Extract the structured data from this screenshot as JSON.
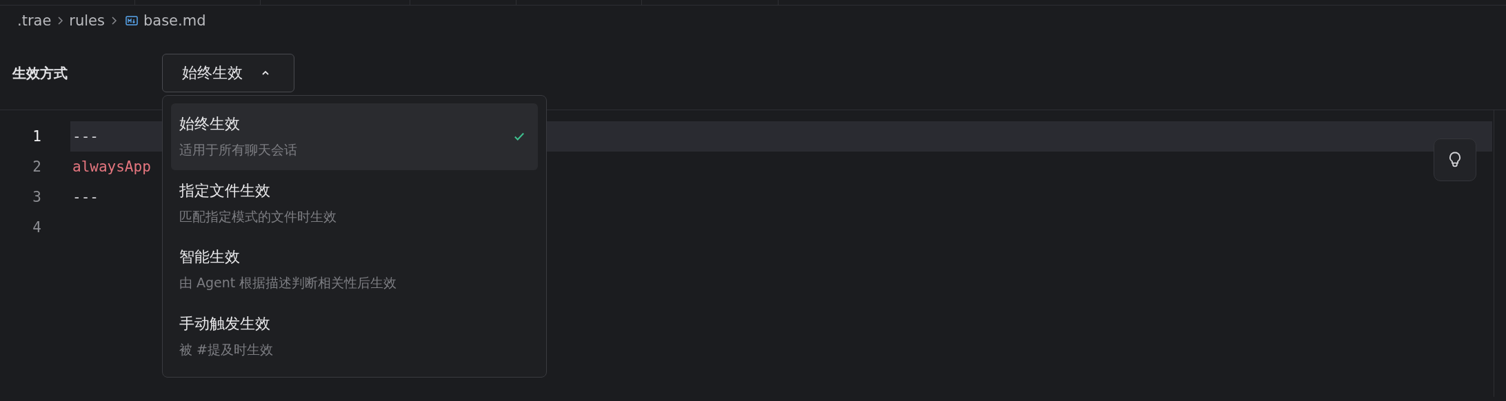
{
  "breadcrumb": [
    {
      "label": ".trae",
      "kind": "folder"
    },
    {
      "label": "rules",
      "kind": "folder"
    },
    {
      "label": "base.md",
      "kind": "markdown"
    }
  ],
  "setting": {
    "label": "生效方式",
    "value": "始终生效",
    "expanded": true
  },
  "menu": [
    {
      "title": "始终生效",
      "description": "适用于所有聊天会话",
      "selected": true
    },
    {
      "title": "指定文件生效",
      "description": "匹配指定模式的文件时生效",
      "selected": false
    },
    {
      "title": "智能生效",
      "description": "由 Agent 根据描述判断相关性后生效",
      "selected": false
    },
    {
      "title": "手动触发生效",
      "description": "被 #提及时生效",
      "selected": false
    }
  ],
  "editor": {
    "lines": [
      {
        "number": "1",
        "text": "---",
        "kind": "punct",
        "selected": true
      },
      {
        "number": "2",
        "text": "alwaysApp",
        "kind": "key",
        "selected": false
      },
      {
        "number": "3",
        "text": "---",
        "kind": "punct",
        "selected": false
      },
      {
        "number": "4",
        "selected": false
      }
    ]
  }
}
